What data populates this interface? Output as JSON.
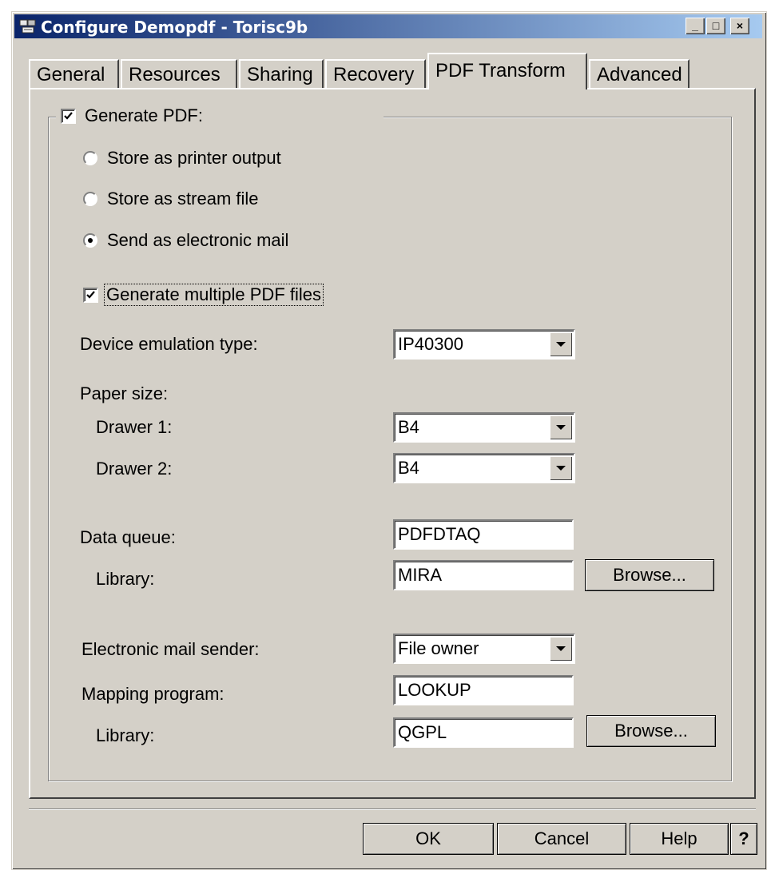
{
  "window": {
    "title": "Configure Demopdf - Torisc9b",
    "controls": {
      "minimize": "_",
      "maximize": "□",
      "close": "×"
    }
  },
  "tabs": [
    {
      "label": "General",
      "active": false
    },
    {
      "label": "Resources",
      "active": false
    },
    {
      "label": "Sharing",
      "active": false
    },
    {
      "label": "Recovery",
      "active": false
    },
    {
      "label": "PDF Transform",
      "active": true
    },
    {
      "label": "Advanced",
      "active": false
    }
  ],
  "pdf": {
    "generate_label": "Generate PDF:",
    "generate_checked": true,
    "options": [
      {
        "label": "Store as printer output",
        "selected": false
      },
      {
        "label": "Store as stream file",
        "selected": false
      },
      {
        "label": "Send as electronic mail",
        "selected": true
      }
    ],
    "multiple_label": "Generate multiple PDF files",
    "multiple_checked": true,
    "device_label": "Device emulation type:",
    "device_value": "IP40300",
    "paper_label": "Paper size:",
    "drawer1_label": "Drawer 1:",
    "drawer1_value": "B4",
    "drawer2_label": "Drawer 2:",
    "drawer2_value": "B4",
    "dataq_label": "Data queue:",
    "dataq_value": "PDFDTAQ",
    "library_label": "Library:",
    "dataq_library_value": "MIRA",
    "browse_label": "Browse...",
    "sender_label": "Electronic mail sender:",
    "sender_value": "File owner",
    "mapping_label": "Mapping program:",
    "mapping_value": "LOOKUP",
    "mapping_library_value": "QGPL"
  },
  "footer": {
    "ok": "OK",
    "cancel": "Cancel",
    "help": "Help",
    "whats_this": "?"
  }
}
